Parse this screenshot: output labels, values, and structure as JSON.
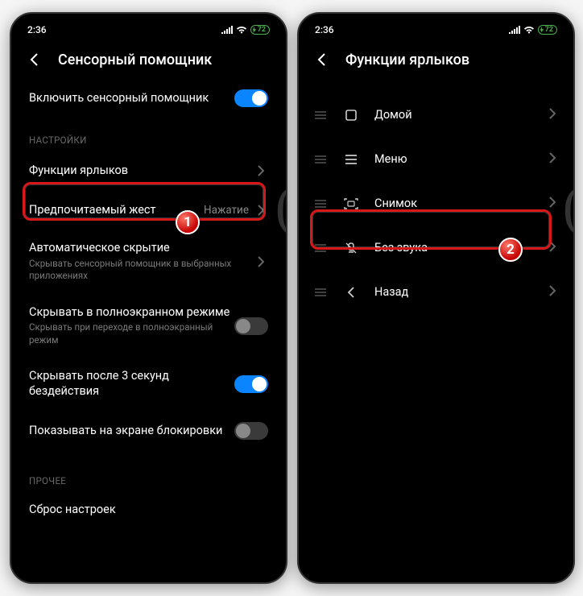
{
  "status": {
    "time": "2:36",
    "battery": "72"
  },
  "left": {
    "title": "Сенсорный помощник",
    "enable_label": "Включить сенсорный помощник",
    "enable_on": true,
    "section_settings": "НАСТРОЙКИ",
    "shortcut_functions": "Функции ярлыков",
    "preferred_gesture": "Предпочитаемый жест",
    "preferred_gesture_value": "Нажатие",
    "auto_hide_title": "Автоматическое скрытие",
    "auto_hide_sub": "Скрывать сенсорный помощник в выбранных приложениях",
    "hide_fullscreen_title": "Скрывать в полноэкранном режиме",
    "hide_fullscreen_sub": "Скрывать при переходе в полноэкранный режим",
    "hide_after_3s": "Скрывать после 3 секунд бездействия",
    "show_on_lock": "Показывать на экране блокировки",
    "section_other": "ПРОЧЕЕ",
    "reset": "Сброс настроек"
  },
  "right": {
    "title": "Функции ярлыков",
    "items": [
      {
        "label": "Домой",
        "icon": "home"
      },
      {
        "label": "Меню",
        "icon": "menu"
      },
      {
        "label": "Снимок",
        "icon": "screenshot"
      },
      {
        "label": "Без звука",
        "icon": "mute"
      },
      {
        "label": "Назад",
        "icon": "back"
      }
    ]
  },
  "callouts": {
    "one": "1",
    "two": "2"
  }
}
